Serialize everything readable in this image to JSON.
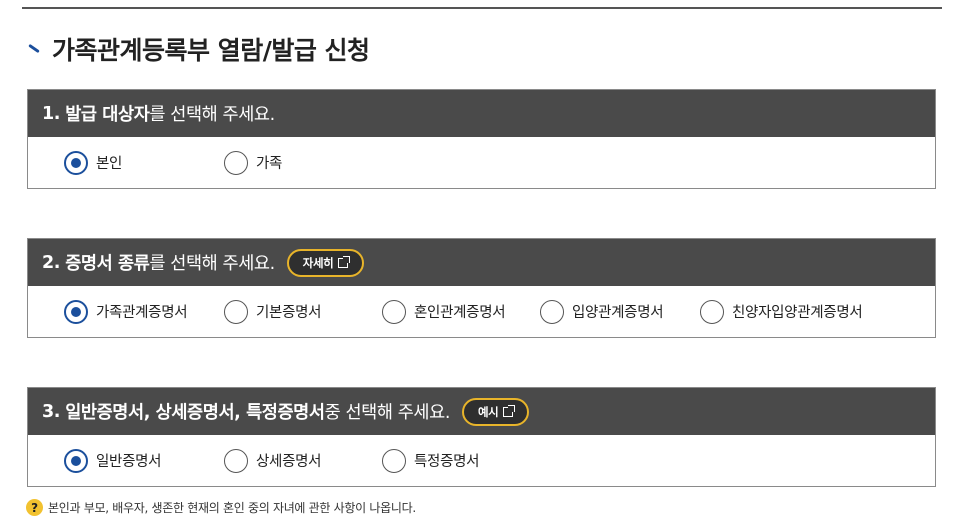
{
  "page": {
    "title": "가족관계등록부 열람/발급 신청"
  },
  "sections": [
    {
      "number": "1.",
      "title_bold": "발급 대상자",
      "title_rest": "를 선택해 주세요.",
      "button_label": "",
      "options": [
        {
          "label": "본인",
          "checked": true
        },
        {
          "label": "가족",
          "checked": false
        }
      ]
    },
    {
      "number": "2.",
      "title_bold": "증명서 종류",
      "title_rest": "를 선택해 주세요.",
      "button_label": "자세히",
      "options": [
        {
          "label": "가족관계증명서",
          "checked": true
        },
        {
          "label": "기본증명서",
          "checked": false
        },
        {
          "label": "혼인관계증명서",
          "checked": false
        },
        {
          "label": "입양관계증명서",
          "checked": false
        },
        {
          "label": "친양자입양관계증명서",
          "checked": false
        }
      ]
    },
    {
      "number": "3.",
      "title_bold": "일반증명서, 상세증명서, 특정증명서",
      "title_rest": " 중 선택해 주세요.",
      "button_label": "예시",
      "options": [
        {
          "label": "일반증명서",
          "checked": true
        },
        {
          "label": "상세증명서",
          "checked": false
        },
        {
          "label": "특정증명서",
          "checked": false
        }
      ]
    }
  ],
  "note": {
    "icon": "question-icon",
    "icon_glyph": "?",
    "text": "본인과 부모, 배우자, 생존한 현재의 혼인 중의 자녀에 관한 사항이 나옵니다."
  },
  "colors": {
    "header_bg": "#4a4a4a",
    "accent_blue": "#1b4f9c",
    "button_border": "#e8b42a"
  }
}
